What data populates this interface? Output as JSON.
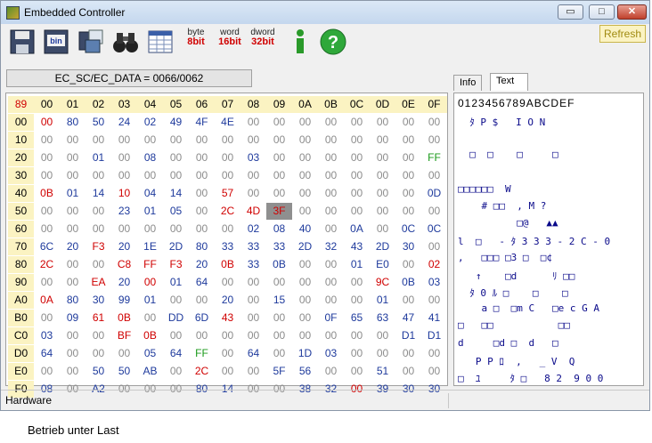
{
  "window": {
    "title": "Embedded Controller"
  },
  "toolbar": {
    "byte": {
      "top": "byte",
      "bottom": "8bit"
    },
    "word": {
      "top": "word",
      "bottom": "16bit"
    },
    "dword": {
      "top": "dword",
      "bottom": "32bit"
    },
    "refresh_label": "Refresh"
  },
  "ec_sc_data": "EC_SC/EC_DATA = 0066/0062",
  "tabs": [
    {
      "label": "Info"
    },
    {
      "label": "Text"
    }
  ],
  "status_bar": {
    "left": "Hardware"
  },
  "bottom_text": "Betrieb unter Last",
  "colors": {
    "default": "#1e3a9c",
    "zero": "#8c8c8c",
    "red": "#d00000",
    "green": "#1a9a1a",
    "highlight_bg": "#8f8f8f"
  },
  "hex": {
    "corner": "89",
    "columns": [
      "00",
      "01",
      "02",
      "03",
      "04",
      "05",
      "06",
      "07",
      "08",
      "09",
      "0A",
      "0B",
      "0C",
      "0D",
      "0E",
      "0F"
    ],
    "rows": [
      {
        "label": "00",
        "cells": [
          "00",
          "80",
          "50",
          "24",
          "02",
          "49",
          "4F",
          "4E",
          "00",
          "00",
          "00",
          "00",
          "00",
          "00",
          "00",
          "00"
        ]
      },
      {
        "label": "10",
        "cells": [
          "00",
          "00",
          "00",
          "00",
          "00",
          "00",
          "00",
          "00",
          "00",
          "00",
          "00",
          "00",
          "00",
          "00",
          "00",
          "00"
        ]
      },
      {
        "label": "20",
        "cells": [
          "00",
          "00",
          "01",
          "00",
          "08",
          "00",
          "00",
          "00",
          "03",
          "00",
          "00",
          "00",
          "00",
          "00",
          "00",
          "FF"
        ]
      },
      {
        "label": "30",
        "cells": [
          "00",
          "00",
          "00",
          "00",
          "00",
          "00",
          "00",
          "00",
          "00",
          "00",
          "00",
          "00",
          "00",
          "00",
          "00",
          "00"
        ]
      },
      {
        "label": "40",
        "cells": [
          "0B",
          "01",
          "14",
          "10",
          "04",
          "14",
          "00",
          "57",
          "00",
          "00",
          "00",
          "00",
          "00",
          "00",
          "00",
          "0D"
        ]
      },
      {
        "label": "50",
        "cells": [
          "00",
          "00",
          "00",
          "23",
          "01",
          "05",
          "00",
          "2C",
          "4D",
          "3F",
          "00",
          "00",
          "00",
          "00",
          "00",
          "00"
        ]
      },
      {
        "label": "60",
        "cells": [
          "00",
          "00",
          "00",
          "00",
          "00",
          "00",
          "00",
          "00",
          "02",
          "08",
          "40",
          "00",
          "0A",
          "00",
          "0C",
          "0C"
        ]
      },
      {
        "label": "70",
        "cells": [
          "6C",
          "20",
          "F3",
          "20",
          "1E",
          "2D",
          "80",
          "33",
          "33",
          "33",
          "2D",
          "32",
          "43",
          "2D",
          "30",
          "00"
        ]
      },
      {
        "label": "80",
        "cells": [
          "2C",
          "00",
          "00",
          "C8",
          "FF",
          "F3",
          "20",
          "0B",
          "33",
          "0B",
          "00",
          "00",
          "01",
          "E0",
          "00",
          "02"
        ]
      },
      {
        "label": "90",
        "cells": [
          "00",
          "00",
          "EA",
          "20",
          "00",
          "01",
          "64",
          "00",
          "00",
          "00",
          "00",
          "00",
          "00",
          "9C",
          "0B",
          "03"
        ]
      },
      {
        "label": "A0",
        "cells": [
          "0A",
          "80",
          "30",
          "99",
          "01",
          "00",
          "00",
          "20",
          "00",
          "15",
          "00",
          "00",
          "00",
          "01",
          "00",
          "00"
        ]
      },
      {
        "label": "B0",
        "cells": [
          "00",
          "09",
          "61",
          "0B",
          "00",
          "DD",
          "6D",
          "43",
          "00",
          "00",
          "00",
          "0F",
          "65",
          "63",
          "47",
          "41"
        ]
      },
      {
        "label": "C0",
        "cells": [
          "03",
          "00",
          "00",
          "BF",
          "0B",
          "00",
          "00",
          "00",
          "00",
          "00",
          "00",
          "00",
          "00",
          "00",
          "D1",
          "D1"
        ]
      },
      {
        "label": "D0",
        "cells": [
          "64",
          "00",
          "00",
          "00",
          "05",
          "64",
          "FF",
          "00",
          "64",
          "00",
          "1D",
          "03",
          "00",
          "00",
          "00",
          "00"
        ]
      },
      {
        "label": "E0",
        "cells": [
          "00",
          "00",
          "50",
          "50",
          "AB",
          "00",
          "2C",
          "00",
          "00",
          "5F",
          "56",
          "00",
          "00",
          "51",
          "00",
          "00"
        ]
      },
      {
        "label": "F0",
        "cells": [
          "08",
          "00",
          "A2",
          "00",
          "00",
          "00",
          "80",
          "14",
          "00",
          "00",
          "38",
          "32",
          "00",
          "39",
          "30",
          "30"
        ]
      }
    ],
    "colored": {
      "r0c0": "red",
      "r4c0": "red",
      "r4c3": "red",
      "r4c7": "red",
      "r5c7": "red",
      "r5c8": "red",
      "r5c9": "red",
      "r7c2": "red",
      "r8c0": "red",
      "r8c3": "red",
      "r8c4": "red",
      "r8c5": "red",
      "r8c7": "red",
      "r8c15": "red",
      "r9c2": "red",
      "r9c4": "red",
      "r9c13": "red",
      "r10c0": "red",
      "r11c2": "red",
      "r11c3": "red",
      "r11c7": "red",
      "r12c3": "red",
      "r12c4": "red",
      "r14c6": "red",
      "r15c12": "red",
      "r2c15": "green",
      "r13c6": "green"
    },
    "highlight": "r5c9"
  },
  "text_view": {
    "header": "0123456789ABCDEF",
    "rows": [
      "  ﾀ P $   I O N",
      "",
      "  □  □    □     □",
      "",
      "□□□□□□  W",
      "    # □□  , M ?",
      "          □@   ▲▲",
      "l  □   - ﾀ 3 3 3 - 2 C - 0",
      ",   □□□ □3 □  □¢",
      "   ↑    □d      ﾘ □□",
      "  ﾀ 0 ﾙ □    □    □",
      "    a □  □m C   □e c G A",
      "□   □□           □□",
      "d     □d □  d   □",
      "   P P ﾛ  ,   _ V  Q",
      "□  ﾕ     ﾀ □   8 2  9 0 0"
    ]
  }
}
